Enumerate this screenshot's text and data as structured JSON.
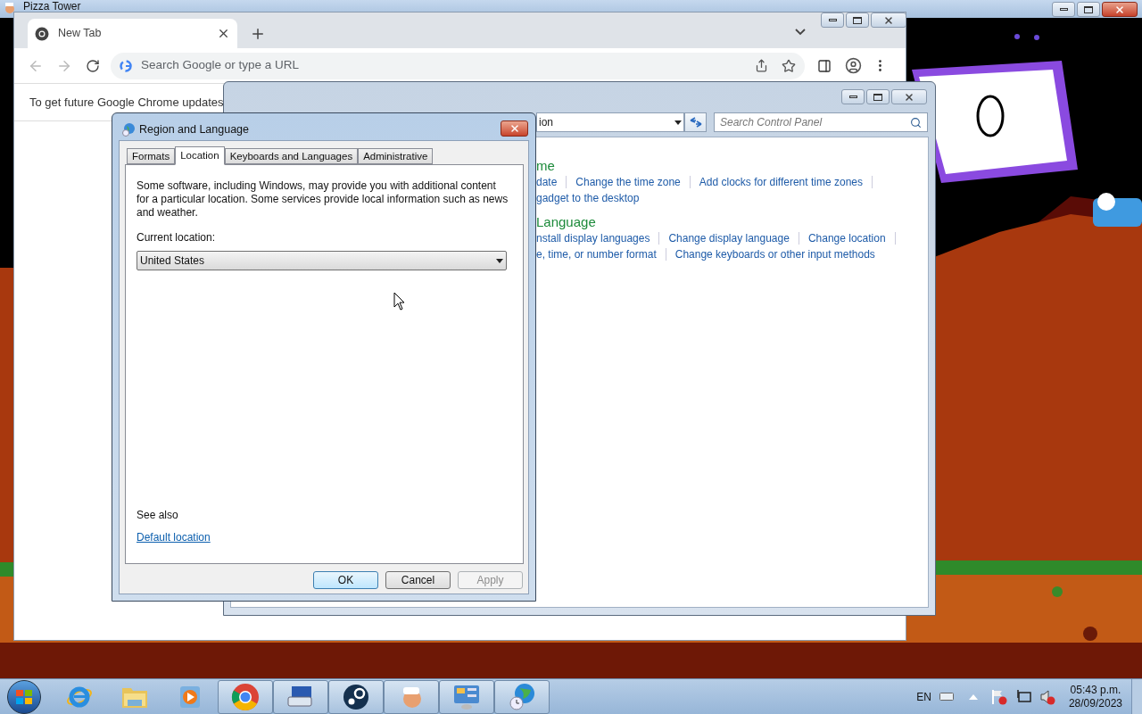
{
  "game_window": {
    "title": "Pizza Tower"
  },
  "browser": {
    "tabs": [
      {
        "label": "New Tab",
        "selected": true
      }
    ],
    "omnibox": {
      "placeholder": "Search Google or type a URL"
    },
    "infobar": "To get future Google Chrome updates"
  },
  "control_panel": {
    "address": "ion",
    "search": {
      "placeholder": "Search Control Panel"
    },
    "sections": [
      {
        "heading": "me",
        "rows": [
          [
            "date",
            "Change the time zone",
            "Add clocks for different time zones"
          ],
          [
            "gadget to the desktop"
          ]
        ]
      },
      {
        "heading": "Language",
        "rows": [
          [
            "nstall display languages",
            "Change display language",
            "Change location"
          ],
          [
            "e, time, or number format",
            "Change keyboards or other input methods"
          ]
        ]
      }
    ]
  },
  "dialog": {
    "title": "Region and Language",
    "tabs": [
      {
        "label": "Formats",
        "selected": false
      },
      {
        "label": "Location",
        "selected": true
      },
      {
        "label": "Keyboards and Languages",
        "selected": false
      },
      {
        "label": "Administrative",
        "selected": false
      }
    ],
    "description": "Some software, including Windows, may provide you with additional content for a particular location. Some services provide local information such as news and weather.",
    "location_label": "Current location:",
    "location": "United States",
    "see_also": "See also",
    "link": "Default location",
    "buttons": [
      {
        "label": "OK",
        "default": true,
        "disabled": false
      },
      {
        "label": "Cancel",
        "default": false,
        "disabled": false
      },
      {
        "label": "Apply",
        "default": false,
        "disabled": true
      }
    ]
  },
  "taskbar": {
    "apps": [
      {
        "kind": "ie",
        "running": false
      },
      {
        "kind": "explorer",
        "running": false
      },
      {
        "kind": "media",
        "running": false
      },
      {
        "kind": "chrome",
        "running": true
      },
      {
        "kind": "keyboard",
        "running": true
      },
      {
        "kind": "steam",
        "running": true
      },
      {
        "kind": "game",
        "running": true
      },
      {
        "kind": "control",
        "running": true
      },
      {
        "kind": "globe",
        "running": true
      }
    ],
    "tray": {
      "language": "EN",
      "time": "05:43 p.m.",
      "date": "28/09/2023"
    }
  }
}
